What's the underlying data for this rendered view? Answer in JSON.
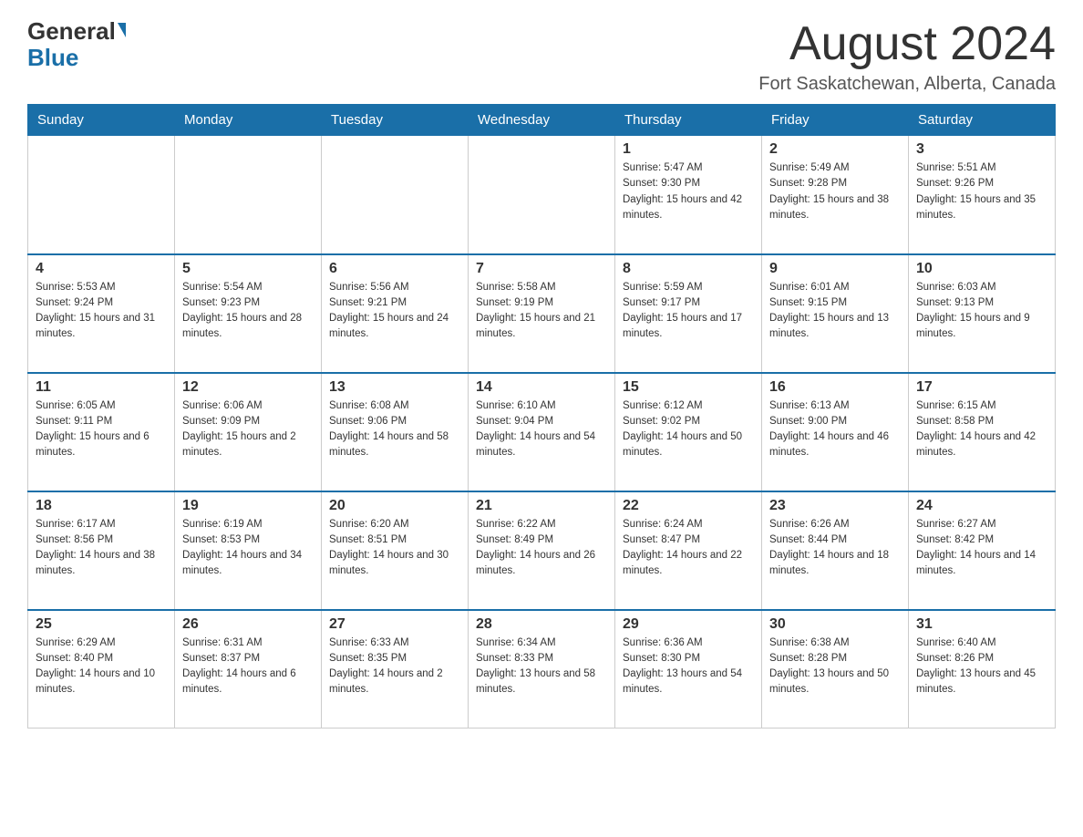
{
  "header": {
    "logo_general": "General",
    "logo_blue": "Blue",
    "month_title": "August 2024",
    "location": "Fort Saskatchewan, Alberta, Canada"
  },
  "calendar": {
    "days_of_week": [
      "Sunday",
      "Monday",
      "Tuesday",
      "Wednesday",
      "Thursday",
      "Friday",
      "Saturday"
    ],
    "weeks": [
      [
        {
          "day": "",
          "info": ""
        },
        {
          "day": "",
          "info": ""
        },
        {
          "day": "",
          "info": ""
        },
        {
          "day": "",
          "info": ""
        },
        {
          "day": "1",
          "info": "Sunrise: 5:47 AM\nSunset: 9:30 PM\nDaylight: 15 hours and 42 minutes."
        },
        {
          "day": "2",
          "info": "Sunrise: 5:49 AM\nSunset: 9:28 PM\nDaylight: 15 hours and 38 minutes."
        },
        {
          "day": "3",
          "info": "Sunrise: 5:51 AM\nSunset: 9:26 PM\nDaylight: 15 hours and 35 minutes."
        }
      ],
      [
        {
          "day": "4",
          "info": "Sunrise: 5:53 AM\nSunset: 9:24 PM\nDaylight: 15 hours and 31 minutes."
        },
        {
          "day": "5",
          "info": "Sunrise: 5:54 AM\nSunset: 9:23 PM\nDaylight: 15 hours and 28 minutes."
        },
        {
          "day": "6",
          "info": "Sunrise: 5:56 AM\nSunset: 9:21 PM\nDaylight: 15 hours and 24 minutes."
        },
        {
          "day": "7",
          "info": "Sunrise: 5:58 AM\nSunset: 9:19 PM\nDaylight: 15 hours and 21 minutes."
        },
        {
          "day": "8",
          "info": "Sunrise: 5:59 AM\nSunset: 9:17 PM\nDaylight: 15 hours and 17 minutes."
        },
        {
          "day": "9",
          "info": "Sunrise: 6:01 AM\nSunset: 9:15 PM\nDaylight: 15 hours and 13 minutes."
        },
        {
          "day": "10",
          "info": "Sunrise: 6:03 AM\nSunset: 9:13 PM\nDaylight: 15 hours and 9 minutes."
        }
      ],
      [
        {
          "day": "11",
          "info": "Sunrise: 6:05 AM\nSunset: 9:11 PM\nDaylight: 15 hours and 6 minutes."
        },
        {
          "day": "12",
          "info": "Sunrise: 6:06 AM\nSunset: 9:09 PM\nDaylight: 15 hours and 2 minutes."
        },
        {
          "day": "13",
          "info": "Sunrise: 6:08 AM\nSunset: 9:06 PM\nDaylight: 14 hours and 58 minutes."
        },
        {
          "day": "14",
          "info": "Sunrise: 6:10 AM\nSunset: 9:04 PM\nDaylight: 14 hours and 54 minutes."
        },
        {
          "day": "15",
          "info": "Sunrise: 6:12 AM\nSunset: 9:02 PM\nDaylight: 14 hours and 50 minutes."
        },
        {
          "day": "16",
          "info": "Sunrise: 6:13 AM\nSunset: 9:00 PM\nDaylight: 14 hours and 46 minutes."
        },
        {
          "day": "17",
          "info": "Sunrise: 6:15 AM\nSunset: 8:58 PM\nDaylight: 14 hours and 42 minutes."
        }
      ],
      [
        {
          "day": "18",
          "info": "Sunrise: 6:17 AM\nSunset: 8:56 PM\nDaylight: 14 hours and 38 minutes."
        },
        {
          "day": "19",
          "info": "Sunrise: 6:19 AM\nSunset: 8:53 PM\nDaylight: 14 hours and 34 minutes."
        },
        {
          "day": "20",
          "info": "Sunrise: 6:20 AM\nSunset: 8:51 PM\nDaylight: 14 hours and 30 minutes."
        },
        {
          "day": "21",
          "info": "Sunrise: 6:22 AM\nSunset: 8:49 PM\nDaylight: 14 hours and 26 minutes."
        },
        {
          "day": "22",
          "info": "Sunrise: 6:24 AM\nSunset: 8:47 PM\nDaylight: 14 hours and 22 minutes."
        },
        {
          "day": "23",
          "info": "Sunrise: 6:26 AM\nSunset: 8:44 PM\nDaylight: 14 hours and 18 minutes."
        },
        {
          "day": "24",
          "info": "Sunrise: 6:27 AM\nSunset: 8:42 PM\nDaylight: 14 hours and 14 minutes."
        }
      ],
      [
        {
          "day": "25",
          "info": "Sunrise: 6:29 AM\nSunset: 8:40 PM\nDaylight: 14 hours and 10 minutes."
        },
        {
          "day": "26",
          "info": "Sunrise: 6:31 AM\nSunset: 8:37 PM\nDaylight: 14 hours and 6 minutes."
        },
        {
          "day": "27",
          "info": "Sunrise: 6:33 AM\nSunset: 8:35 PM\nDaylight: 14 hours and 2 minutes."
        },
        {
          "day": "28",
          "info": "Sunrise: 6:34 AM\nSunset: 8:33 PM\nDaylight: 13 hours and 58 minutes."
        },
        {
          "day": "29",
          "info": "Sunrise: 6:36 AM\nSunset: 8:30 PM\nDaylight: 13 hours and 54 minutes."
        },
        {
          "day": "30",
          "info": "Sunrise: 6:38 AM\nSunset: 8:28 PM\nDaylight: 13 hours and 50 minutes."
        },
        {
          "day": "31",
          "info": "Sunrise: 6:40 AM\nSunset: 8:26 PM\nDaylight: 13 hours and 45 minutes."
        }
      ]
    ]
  }
}
